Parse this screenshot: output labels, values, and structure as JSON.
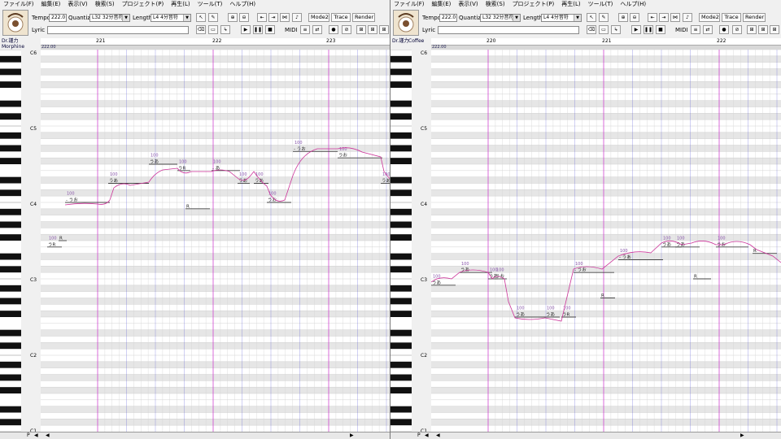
{
  "menu": [
    "ファイル(F)",
    "編集(E)",
    "表示(V)",
    "検索(S)",
    "プロジェクト(P)",
    "再生(L)",
    "ツール(T)",
    "ヘルプ(H)"
  ],
  "toolbar": {
    "tempo_label": "Tempo",
    "tempo_value": "222.0",
    "quantize_label": "Quantize",
    "quantize_value": "L32 32分音符",
    "length_label": "Length",
    "length_value": "L4 4分音符",
    "lyric_label": "Lyric",
    "midi_label": "MIDI",
    "mode2_label": "Mode2",
    "trace_label": "Trace",
    "render_label": "Render"
  },
  "left": {
    "track_line1": "Dr.謹力",
    "track_line2": "Morphine",
    "tempo_mark": "222.00",
    "measures": [
      "221",
      "222",
      "223"
    ],
    "octaves": [
      "C6",
      "C5",
      "C4",
      "C3",
      "C2",
      "C1"
    ],
    "notes": [
      {
        "lyric": "- うお",
        "vel": "100"
      },
      {
        "lyric": "うあ",
        "vel": "100"
      },
      {
        "lyric": "うあ",
        "vel": "100"
      },
      {
        "lyric": "うR",
        "vel": "100"
      },
      {
        "lyric": "R",
        "vel": ""
      },
      {
        "lyric": "- あ",
        "vel": "100"
      },
      {
        "lyric": "うあ",
        "vel": "100"
      },
      {
        "lyric": "うあ",
        "vel": "100"
      },
      {
        "lyric": "うお",
        "vel": "100"
      },
      {
        "lyric": "- うお",
        "vel": "100"
      },
      {
        "lyric": "うお",
        "vel": "100"
      },
      {
        "lyric": "うあ",
        "vel": "100"
      },
      {
        "lyric": "うR",
        "vel": "100"
      },
      {
        "lyric": "R",
        "vel": ""
      }
    ]
  },
  "right": {
    "track_line1": "Dr.謹力",
    "track_line2": "Coffee",
    "tempo_mark": "222.00",
    "measures": [
      "220",
      "221",
      "222"
    ],
    "octaves": [
      "C6",
      "C5",
      "C4",
      "C3",
      "C2",
      "C1"
    ],
    "notes": [
      {
        "lyric": "うあ",
        "vel": "100"
      },
      {
        "lyric": "うあ",
        "vel": "100"
      },
      {
        "lyric": "うあ",
        "vel": "100"
      },
      {
        "lyric": "うお",
        "vel": "100"
      },
      {
        "lyric": "うあ",
        "vel": "100"
      },
      {
        "lyric": "うあ",
        "vel": "100"
      },
      {
        "lyric": "うR",
        "vel": "100"
      },
      {
        "lyric": "R",
        "vel": ""
      },
      {
        "lyric": "- うお",
        "vel": "100"
      },
      {
        "lyric": "R",
        "vel": ""
      },
      {
        "lyric": "- うあ",
        "vel": "100"
      },
      {
        "lyric": "うあ",
        "vel": "100"
      },
      {
        "lyric": "うあ",
        "vel": "100"
      },
      {
        "lyric": "うお",
        "vel": "100"
      },
      {
        "lyric": "R",
        "vel": ""
      }
    ]
  },
  "bottom_p": "P",
  "colors": {
    "note": "#444444",
    "pitch": "#cc3399",
    "measure_line": "#cc33cc",
    "beat_line": "#3333cc",
    "white_row": "#ffffff",
    "black_row": "#e6e6e6"
  }
}
